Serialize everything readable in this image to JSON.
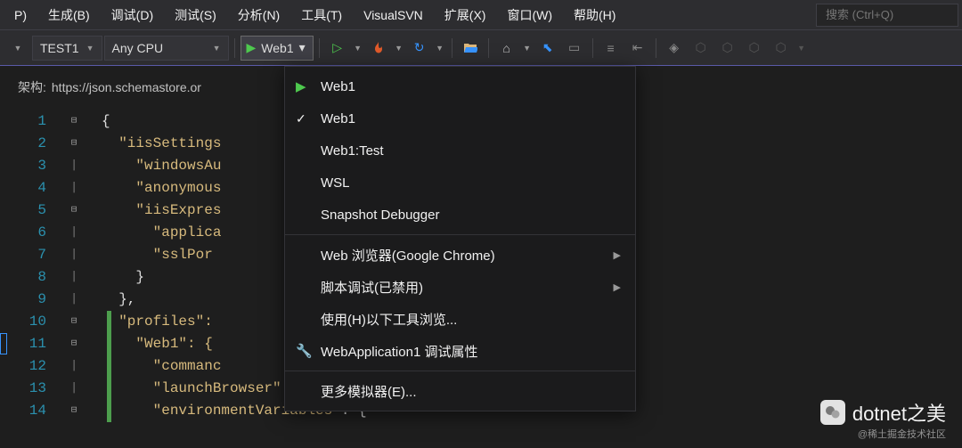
{
  "menubar": {
    "items": [
      "P)",
      "生成(B)",
      "调试(D)",
      "测试(S)",
      "分析(N)",
      "工具(T)",
      "VisualSVN",
      "扩展(X)",
      "窗口(W)",
      "帮助(H)"
    ]
  },
  "search": {
    "placeholder": "搜索 (Ctrl+Q)"
  },
  "toolbar": {
    "config": "TEST1",
    "platform": "Any CPU",
    "start_label": "Web1"
  },
  "schema": {
    "label": "架构:",
    "url": "https://json.schemastore.or"
  },
  "code": {
    "lines": [
      {
        "n": "1",
        "t": "{"
      },
      {
        "n": "2",
        "t": "  \"iisSettings"
      },
      {
        "n": "3",
        "t": "    \"windowsAu"
      },
      {
        "n": "4",
        "t": "    \"anonymous"
      },
      {
        "n": "5",
        "t": "    \"iisExpres"
      },
      {
        "n": "6",
        "t": "      \"applica"
      },
      {
        "n": "7",
        "t": "      \"sslPor"
      },
      {
        "n": "8",
        "t": "    }"
      },
      {
        "n": "9",
        "t": "  },"
      },
      {
        "n": "10",
        "t": "  \"profiles\": "
      },
      {
        "n": "11",
        "t": "    \"Web1\": {"
      },
      {
        "n": "12",
        "t": "      \"commanc"
      },
      {
        "n": "13",
        "t": "      \"launchBrowser\": true,"
      },
      {
        "n": "14",
        "t": "      \"environmentVariables\": {"
      }
    ]
  },
  "dropdown": {
    "items": [
      {
        "label": "Web1",
        "icon": "play"
      },
      {
        "label": "Web1",
        "icon": "check"
      },
      {
        "label": "Web1:Test"
      },
      {
        "label": "WSL"
      },
      {
        "label": "Snapshot Debugger"
      }
    ],
    "group2": [
      {
        "label": "Web 浏览器(Google Chrome)",
        "submenu": true
      },
      {
        "label": "脚本调试(已禁用)",
        "submenu": true
      },
      {
        "label": "使用(H)以下工具浏览..."
      },
      {
        "label": "WebApplication1 调试属性",
        "icon": "wrench"
      }
    ],
    "group3": [
      {
        "label": "更多模拟器(E)..."
      }
    ]
  },
  "watermark": {
    "text": "dotnet之美",
    "sub": "@稀土掘金技术社区"
  }
}
